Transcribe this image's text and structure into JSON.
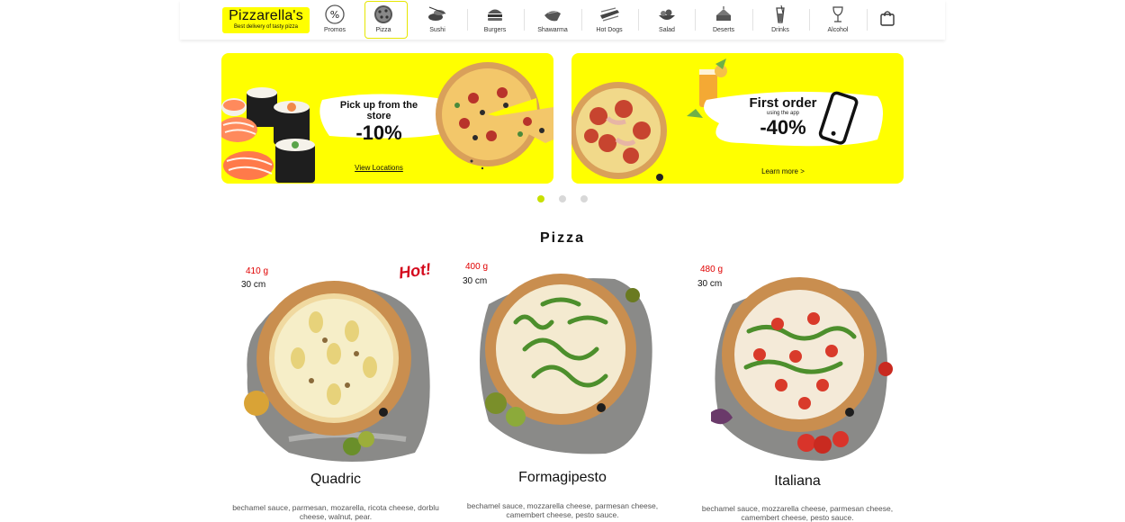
{
  "brand": {
    "name": "Pizzarella's",
    "tagline": "Best delivery of tasty pizza",
    "accent": "#ffff00"
  },
  "nav": [
    {
      "label": "Promos",
      "icon": "percent-icon"
    },
    {
      "label": "Pizza",
      "icon": "pizza-icon",
      "active": true
    },
    {
      "label": "Sushi",
      "icon": "sushi-icon"
    },
    {
      "label": "Burgers",
      "icon": "burger-icon"
    },
    {
      "label": "Shawarma",
      "icon": "shawarma-icon"
    },
    {
      "label": "Hot Dogs",
      "icon": "hot-dog-icon"
    },
    {
      "label": "Salad",
      "icon": "salad-icon"
    },
    {
      "label": "Deserts",
      "icon": "dessert-icon"
    },
    {
      "label": "Drinks",
      "icon": "drinks-icon"
    },
    {
      "label": "Alcohol",
      "icon": "alcohol-icon"
    }
  ],
  "cart_icon": "shopping-bag-icon",
  "banners": [
    {
      "title": "Pick up from the store",
      "discount": "-10%",
      "link": "View Locations"
    },
    {
      "title": "First order",
      "subtitle": "using the app",
      "discount": "-40%",
      "link": "Learn more"
    }
  ],
  "carousel": {
    "slides": 3,
    "active": 0
  },
  "section_title": "Pizza",
  "products": [
    {
      "weight": "410 g",
      "size": "30 cm",
      "badge": "Hot!",
      "name": "Quadric",
      "description": "bechamel sauce, parmesan, mozarella, ricota cheese, dorblu cheese, walnut, pear."
    },
    {
      "weight": "400 g",
      "size": "30 cm",
      "name": "Formagipesto",
      "description": "bechamel sauce, mozzarella cheese, parmesan cheese, camembert cheese, pesto sauce."
    },
    {
      "weight": "480 g",
      "size": "30 cm",
      "name": "Italiana",
      "description": "bechamel sauce, mozzarella cheese, parmesan cheese, camembert cheese, pesto sauce."
    }
  ]
}
